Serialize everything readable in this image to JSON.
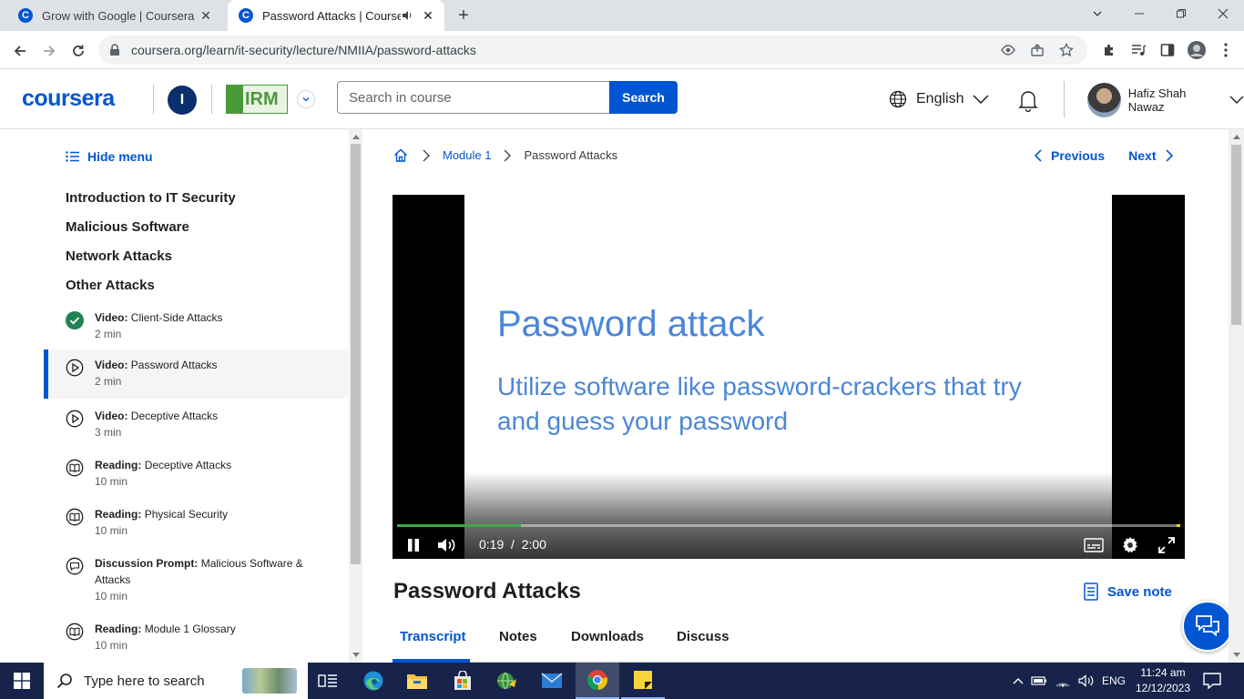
{
  "browser": {
    "tabs": [
      {
        "title": "Grow with Google | Coursera",
        "favicon": "C"
      },
      {
        "title": "Password Attacks | Coursera",
        "favicon": "C"
      }
    ],
    "url": "coursera.org/learn/it-security/lecture/NMIIA/password-attacks"
  },
  "header": {
    "logo": "coursera",
    "institution_initial": "I",
    "partner_logo": "IRM",
    "search_placeholder": "Search in course",
    "search_button": "Search",
    "language": "English",
    "user_name": "Hafiz Shah Nawaz"
  },
  "sidebar": {
    "hide_menu": "Hide menu",
    "modules": [
      "Introduction to IT Security",
      "Malicious Software",
      "Network Attacks",
      "Other Attacks"
    ],
    "items": [
      {
        "type": "Video:",
        "title": "Client-Side Attacks",
        "duration": "2 min",
        "status": "completed"
      },
      {
        "type": "Video:",
        "title": "Password Attacks",
        "duration": "2 min",
        "status": "current"
      },
      {
        "type": "Video:",
        "title": "Deceptive Attacks",
        "duration": "3 min",
        "status": "todo"
      },
      {
        "type": "Reading:",
        "title": "Deceptive Attacks",
        "duration": "10 min",
        "status": "todo"
      },
      {
        "type": "Reading:",
        "title": "Physical Security",
        "duration": "10 min",
        "status": "todo"
      },
      {
        "type": "Discussion Prompt:",
        "title": "Malicious Software & Attacks",
        "duration": "10 min",
        "status": "todo"
      },
      {
        "type": "Reading:",
        "title": "Module 1 Glossary",
        "duration": "10 min",
        "status": "todo"
      }
    ]
  },
  "breadcrumb": {
    "module": "Module 1",
    "current": "Password Attacks"
  },
  "nav": {
    "previous": "Previous",
    "next": "Next"
  },
  "video": {
    "slide_title": "Password attack",
    "slide_body": "Utilize software like password-crackers that try and guess your password",
    "current_time": "0:19",
    "separator": "/",
    "duration": "2:00",
    "progress_fraction": 0.158
  },
  "lecture": {
    "title": "Password Attacks",
    "save_note": "Save note",
    "tabs": [
      "Transcript",
      "Notes",
      "Downloads",
      "Discuss"
    ],
    "selected_tab": "Transcript"
  },
  "taskbar": {
    "search_placeholder": "Type here to search",
    "language": "ENG",
    "time": "11:24 am",
    "date": "12/12/2023"
  },
  "colors": {
    "brand": "#0056d2",
    "completed": "#1f8354",
    "slide_text": "#4a86d8"
  }
}
